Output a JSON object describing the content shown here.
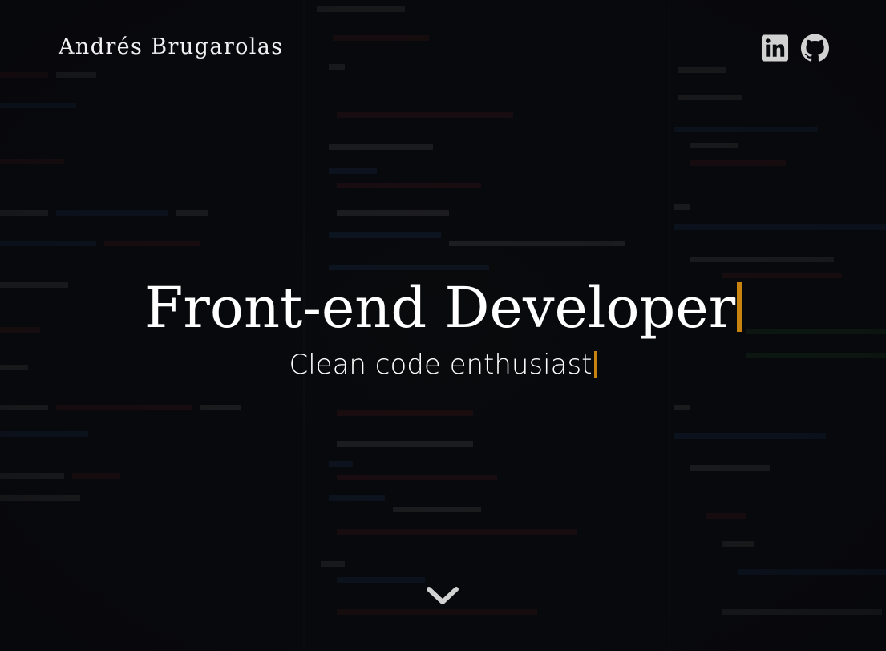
{
  "header": {
    "site_name": "Andrés Brugarolas"
  },
  "social": {
    "items": [
      {
        "name": "LinkedIn",
        "icon": "linkedin-icon"
      },
      {
        "name": "GitHub",
        "icon": "github-icon"
      }
    ]
  },
  "hero": {
    "title": "Front-end Developer",
    "subtitle": "Clean code enthusiast",
    "scroll_icon": "chevron-down-icon"
  },
  "colors": {
    "background": "#0a0b0e",
    "text": "#ffffff",
    "icon": "#d2d2d2",
    "cursor_accent": "#c8820f"
  }
}
